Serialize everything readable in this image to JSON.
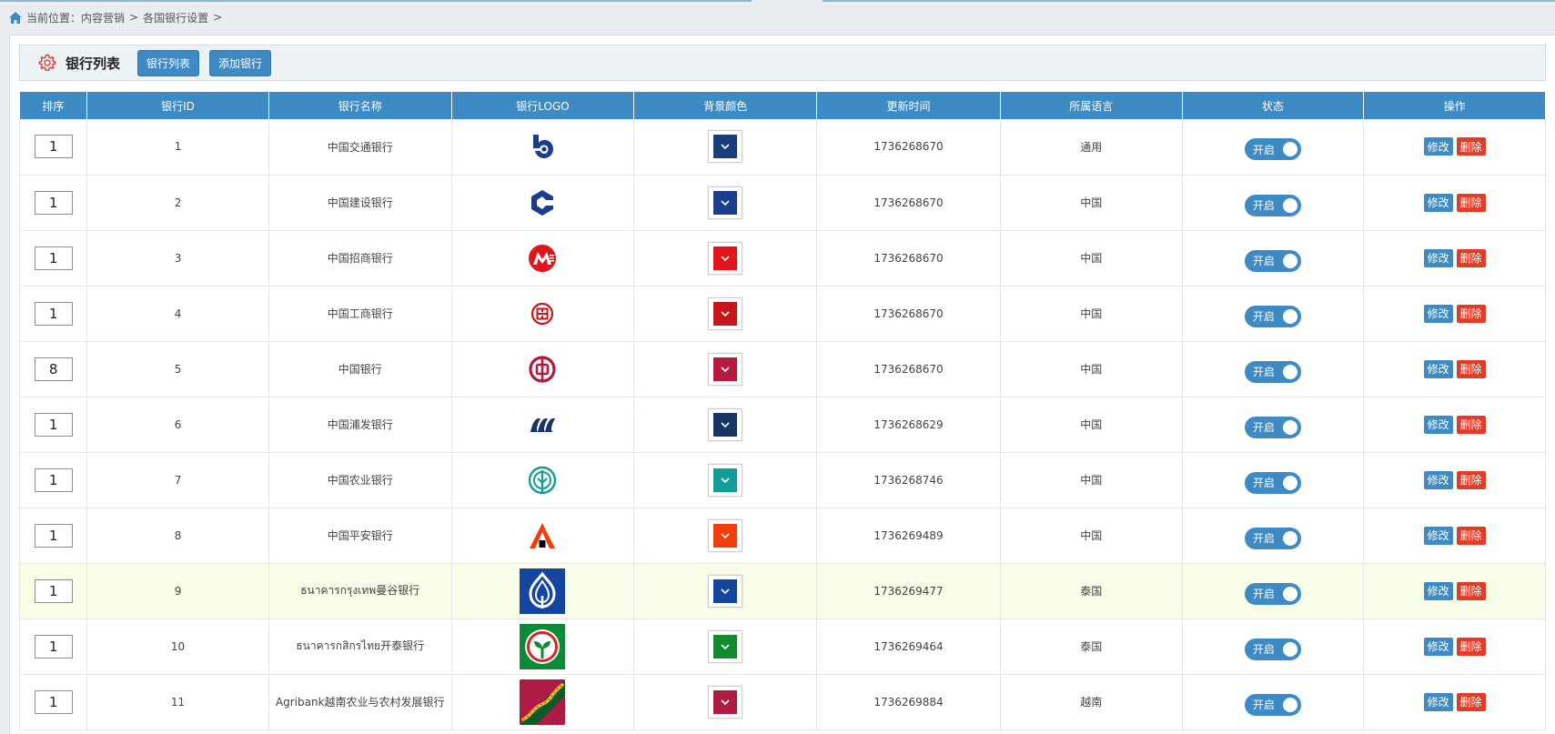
{
  "breadcrumb": {
    "prefix": "当前位置：",
    "items": [
      "内容营销",
      "各国银行设置"
    ],
    "separator": ">"
  },
  "toolbar": {
    "title": "银行列表",
    "buttons": [
      "银行列表",
      "添加银行"
    ]
  },
  "table": {
    "headers": [
      "排序",
      "银行ID",
      "银行名称",
      "银行LOGO",
      "背景颜色",
      "更新时间",
      "所属语言",
      "状态",
      "操作"
    ],
    "toggle_label": "开启",
    "edit_label": "修改",
    "delete_label": "删除",
    "rows": [
      {
        "sort": "1",
        "id": "1",
        "name": "中国交通银行",
        "logo": "bocom-logo",
        "color": "#1a3d7c",
        "updated": "1736268670",
        "lang": "通用"
      },
      {
        "sort": "1",
        "id": "2",
        "name": "中国建设银行",
        "logo": "ccb-logo",
        "color": "#1a3d8c",
        "updated": "1736268670",
        "lang": "中国"
      },
      {
        "sort": "1",
        "id": "3",
        "name": "中国招商银行",
        "logo": "cmb-logo",
        "color": "#e5141c",
        "updated": "1736268670",
        "lang": "中国"
      },
      {
        "sort": "1",
        "id": "4",
        "name": "中国工商银行",
        "logo": "icbc-logo",
        "color": "#c4161c",
        "updated": "1736268670",
        "lang": "中国"
      },
      {
        "sort": "8",
        "id": "5",
        "name": "中国银行",
        "logo": "boc-logo",
        "color": "#b5193c",
        "updated": "1736268670",
        "lang": "中国"
      },
      {
        "sort": "1",
        "id": "6",
        "name": "中国浦发银行",
        "logo": "spdb-logo",
        "color": "#1b3466",
        "updated": "1736268629",
        "lang": "中国"
      },
      {
        "sort": "1",
        "id": "7",
        "name": "中国农业银行",
        "logo": "abc-logo",
        "color": "#129e98",
        "updated": "1736268746",
        "lang": "中国"
      },
      {
        "sort": "1",
        "id": "8",
        "name": "中国平安银行",
        "logo": "pingan-logo",
        "color": "#f23d0c",
        "updated": "1736269489",
        "lang": "中国"
      },
      {
        "sort": "1",
        "id": "9",
        "name": "ธนาคารกรุงเทพ曼谷银行",
        "logo": "bangkok-bank-logo",
        "color": "#1446a0",
        "updated": "1736269477",
        "lang": "泰国",
        "highlight": true
      },
      {
        "sort": "1",
        "id": "10",
        "name": "ธนาคารกสิกรไทย开泰银行",
        "logo": "kasikorn-logo",
        "color": "#138a2e",
        "updated": "1736269464",
        "lang": "泰国"
      },
      {
        "sort": "1",
        "id": "11",
        "name": "Agribank越南农业与农村发展银行",
        "logo": "agribank-logo",
        "color": "#ae1c45",
        "updated": "1736269884",
        "lang": "越南"
      }
    ]
  }
}
